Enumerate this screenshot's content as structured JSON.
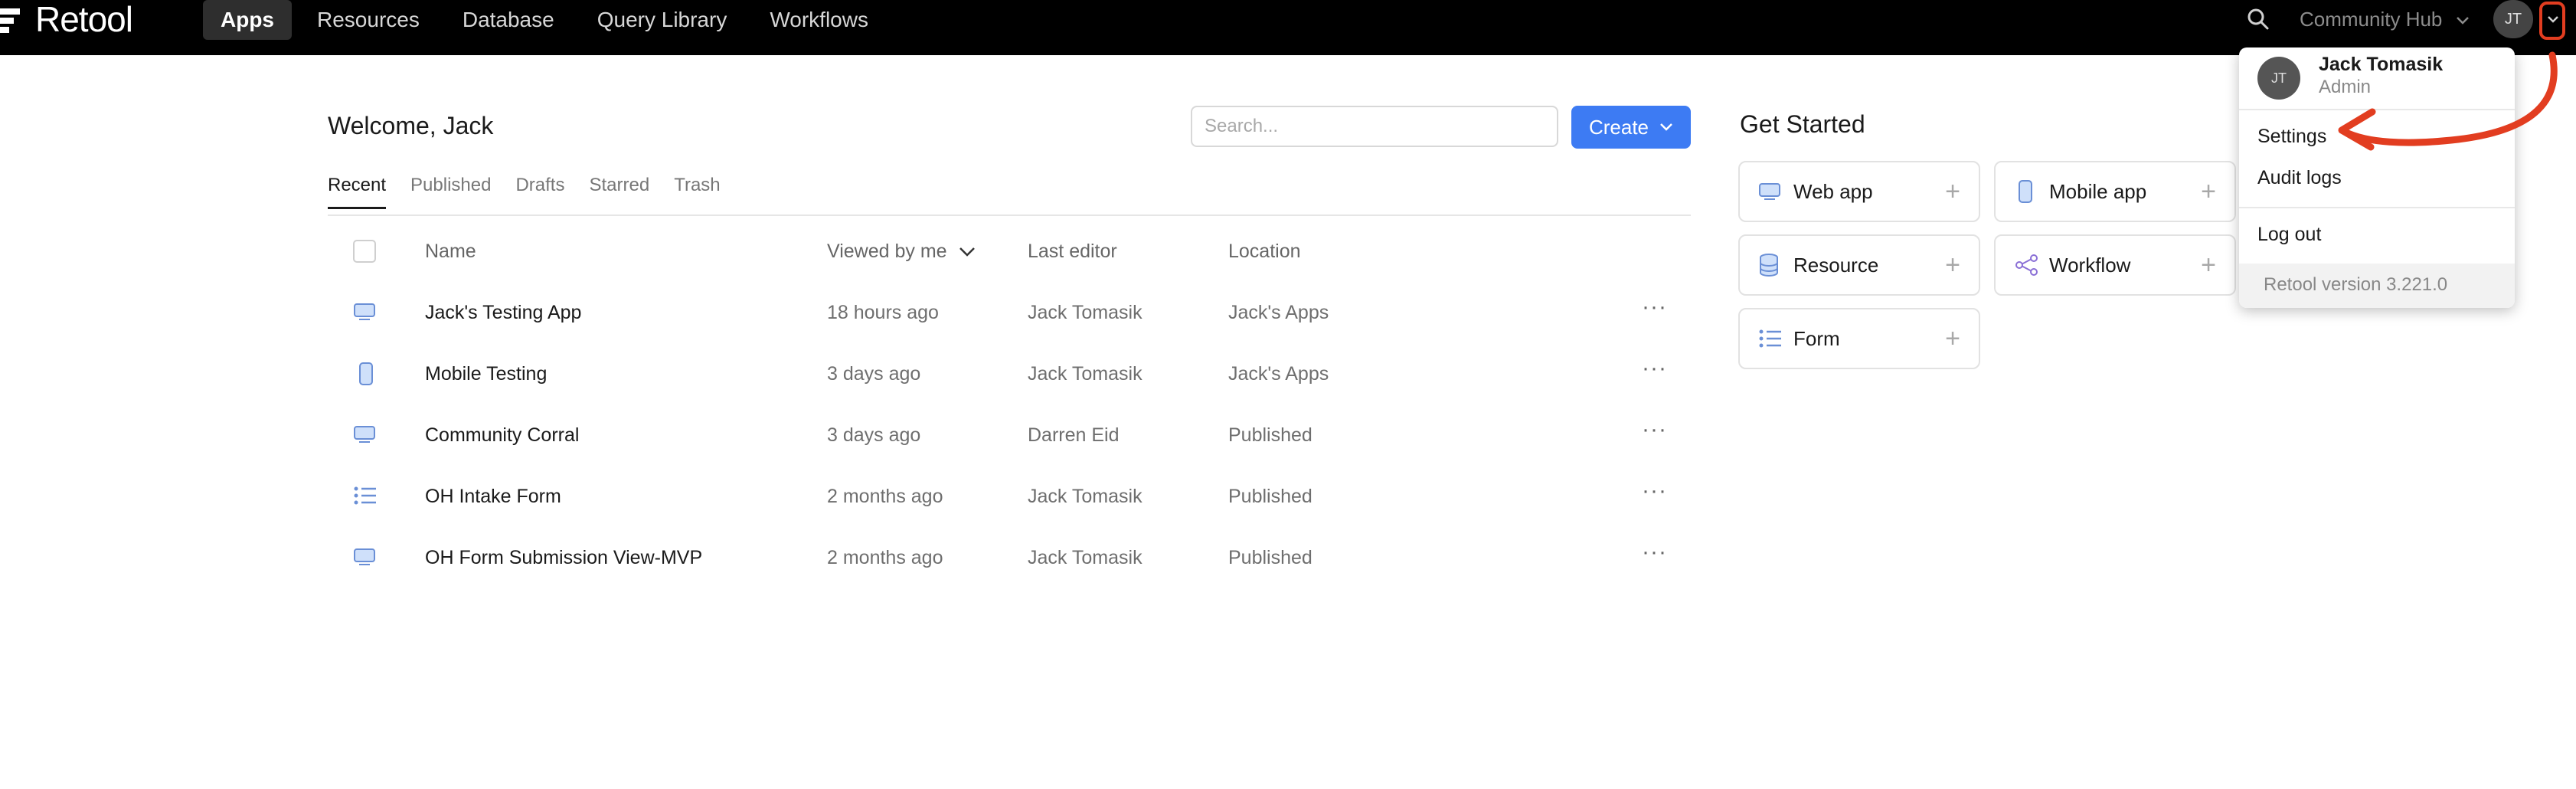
{
  "app": {
    "logo_text": "Retool"
  },
  "nav": {
    "items": [
      {
        "label": "Apps",
        "active": true
      },
      {
        "label": "Resources",
        "active": false
      },
      {
        "label": "Database",
        "active": false
      },
      {
        "label": "Query Library",
        "active": false
      },
      {
        "label": "Workflows",
        "active": false
      }
    ]
  },
  "topbar": {
    "community_hub": "Community Hub",
    "avatar_initials": "JT",
    "search_icon": "search-icon",
    "chevron_icon": "chevron-down-icon"
  },
  "main": {
    "welcome": "Welcome, Jack",
    "search_placeholder": "Search...",
    "create_label": "Create",
    "tabs": [
      {
        "label": "Recent",
        "active": true
      },
      {
        "label": "Published",
        "active": false
      },
      {
        "label": "Drafts",
        "active": false
      },
      {
        "label": "Starred",
        "active": false
      },
      {
        "label": "Trash",
        "active": false
      }
    ],
    "columns": {
      "name": "Name",
      "viewed": "Viewed by me",
      "editor": "Last editor",
      "location": "Location"
    },
    "rows": [
      {
        "icon": "desktop-icon",
        "name": "Jack's Testing App",
        "viewed": "18 hours ago",
        "editor": "Jack Tomasik",
        "location": "Jack's Apps",
        "more": "···"
      },
      {
        "icon": "mobile-icon",
        "name": "Mobile Testing",
        "viewed": "3 days ago",
        "editor": "Jack Tomasik",
        "location": "Jack's Apps",
        "more": "···"
      },
      {
        "icon": "desktop-icon",
        "name": "Community Corral",
        "viewed": "3 days ago",
        "editor": "Darren Eid",
        "location": "Published",
        "more": "···"
      },
      {
        "icon": "list-icon",
        "name": "OH Intake Form",
        "viewed": "2 months ago",
        "editor": "Jack Tomasik",
        "location": "Published",
        "more": "···"
      },
      {
        "icon": "desktop-icon",
        "name": "OH Form Submission View-MVP",
        "viewed": "2 months ago",
        "editor": "Jack Tomasik",
        "location": "Published",
        "more": "···"
      }
    ]
  },
  "get_started": {
    "title": "Get Started",
    "cards": [
      {
        "label": "Web app",
        "icon": "desktop-icon"
      },
      {
        "label": "Mobile app",
        "icon": "mobile-icon"
      },
      {
        "label": "Resource",
        "icon": "database-icon"
      },
      {
        "label": "Workflow",
        "icon": "workflow-icon"
      },
      {
        "label": "Form",
        "icon": "list-icon"
      }
    ],
    "plus": "+"
  },
  "dropdown": {
    "avatar_initials": "JT",
    "user_name": "Jack Tomasik",
    "user_role": "Admin",
    "settings": "Settings",
    "audit_logs": "Audit logs",
    "log_out": "Log out",
    "version": "Retool version 3.221.0"
  },
  "colors": {
    "topbar_bg": "#000000",
    "accent": "#3d7bf3",
    "annotation": "#e23d20",
    "icon_blue": "#6a8fd6"
  }
}
